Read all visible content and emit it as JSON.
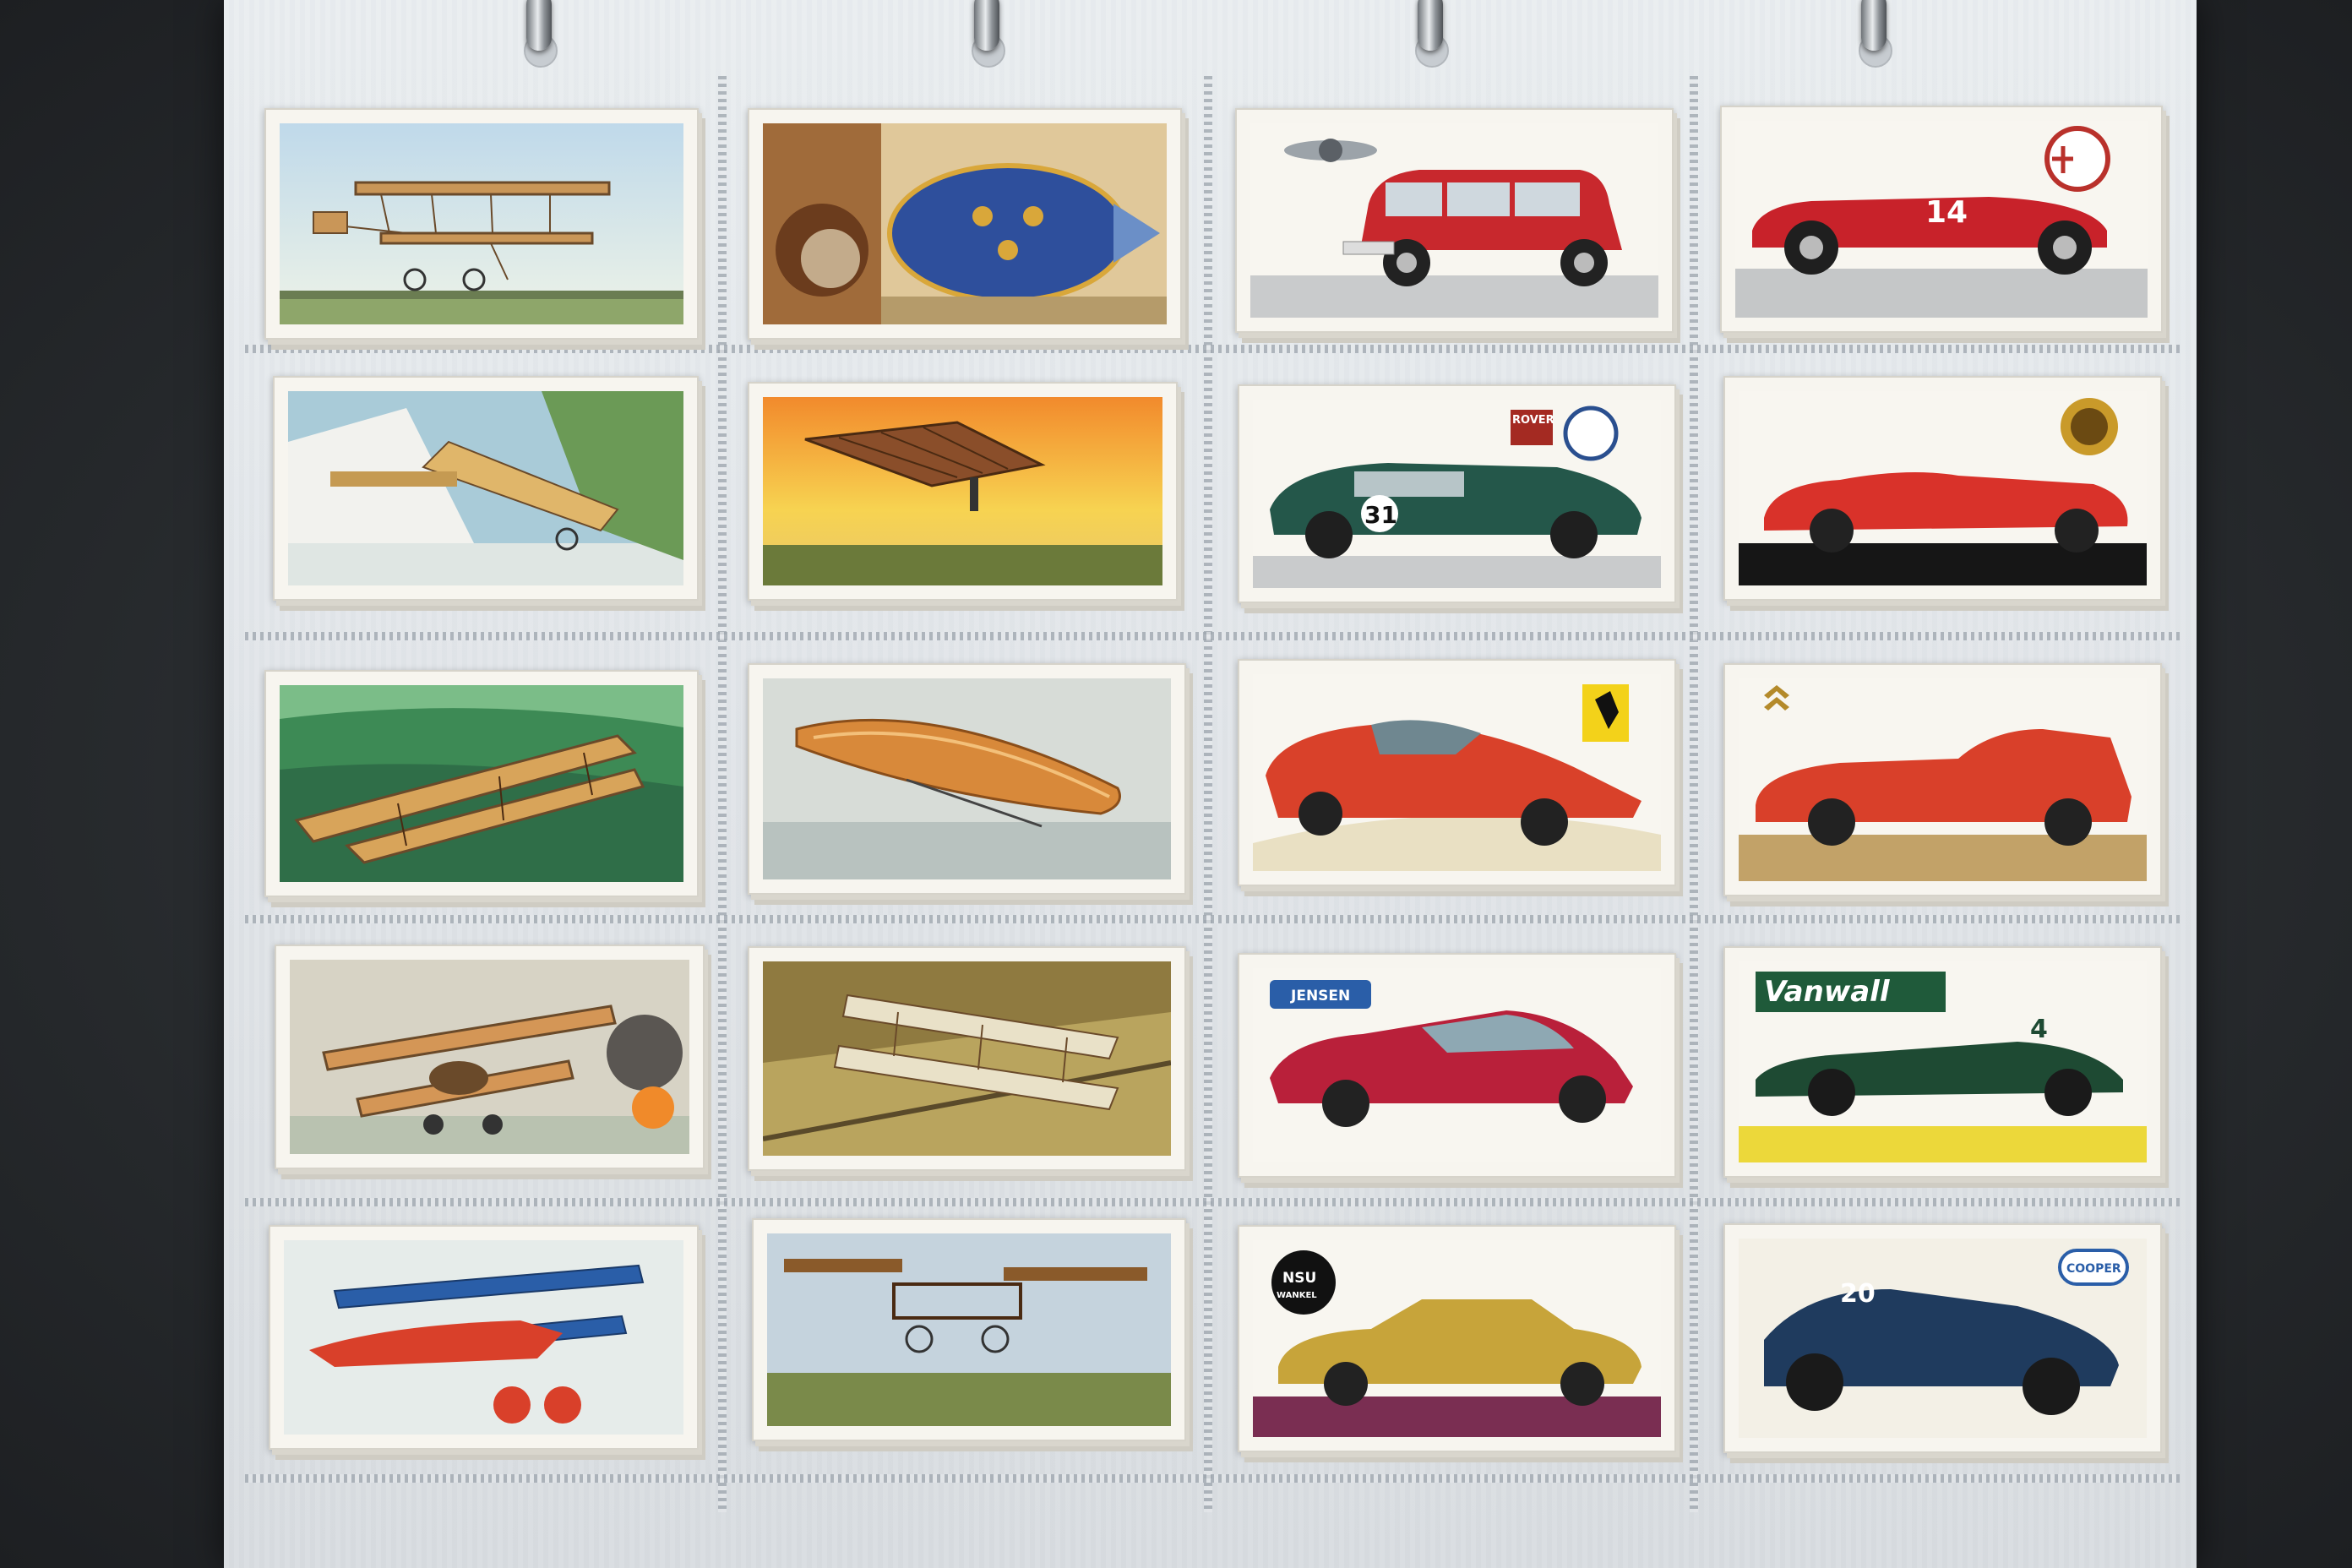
{
  "scene": {
    "accent_colors": {
      "background": "#2b2f33",
      "sleeve": "#e2e6ea",
      "card": "#f7f5ef"
    }
  },
  "cards": {
    "vanwall": {
      "logo": "Vanwall",
      "number": "4"
    },
    "jensen": {
      "logo": "JENSEN"
    },
    "nsu": {
      "logo_top": "NSU",
      "logo_bottom": "WANKEL"
    },
    "cooper": {
      "logo": "COOPER",
      "number": "20"
    },
    "rover": {
      "logo": "ROVER",
      "number": "31"
    },
    "alfa": {
      "number": "14"
    }
  }
}
